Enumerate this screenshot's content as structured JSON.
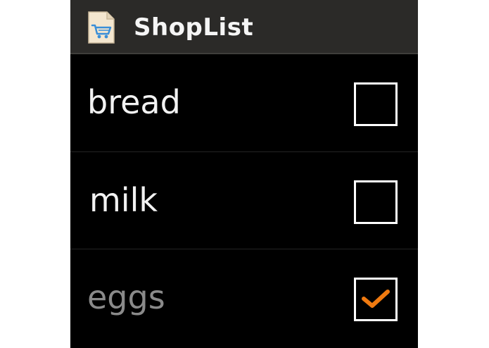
{
  "app": {
    "title": "ShopList",
    "icon": "shopping-cart-icon"
  },
  "colors": {
    "titlebar_bg": "#2b2a28",
    "list_bg": "#000000",
    "text": "#f2f2f2",
    "checked_text": "#8a8a8a",
    "check_accent": "#f07a10"
  },
  "items": [
    {
      "label": "bread",
      "checked": false
    },
    {
      "label": "milk",
      "checked": false
    },
    {
      "label": "eggs",
      "checked": true
    }
  ]
}
